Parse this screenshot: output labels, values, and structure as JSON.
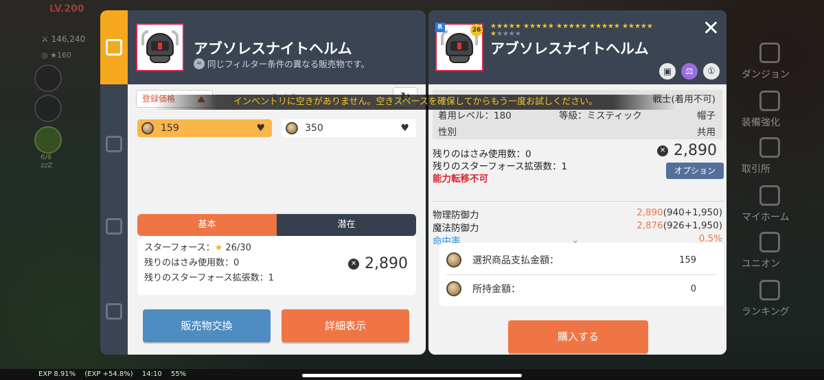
{
  "hud": {
    "level": "LV.200",
    "hp": "146,240",
    "location": "★160",
    "left_badge_count": "6/6",
    "left_badge_sub": "zzZ"
  },
  "right_menu": [
    {
      "label": "ダンジョン",
      "icon": "dungeon-icon"
    },
    {
      "label": "装備強化",
      "icon": "anvil-icon"
    },
    {
      "label": "取引所",
      "icon": "scale-icon"
    },
    {
      "label": "マイホーム",
      "icon": "mushroom-house-icon"
    },
    {
      "label": "ユニオン",
      "icon": "union-icon"
    },
    {
      "label": "ランキング",
      "icon": "trophy-icon"
    }
  ],
  "bottom_bar": {
    "exp": "EXP 8.91%",
    "exp_bonus": "(EXP +54.8%)",
    "time": "14:10",
    "battery": "55%"
  },
  "left_panel": {
    "side_tabs": [
      {
        "icon": "chart-icon",
        "active": true
      },
      {
        "icon": "helmet-icon",
        "active": false
      },
      {
        "icon": "hanger-icon",
        "active": false
      },
      {
        "icon": "heart-icon",
        "active": false
      }
    ],
    "item_name": "アブソレスナイトヘルム",
    "subtitle": "同じフィルター条件の異なる販売物です。",
    "sort_label": "登録価格",
    "pager": "1/1",
    "listings": [
      {
        "price": "159",
        "selected": true
      },
      {
        "price": "350",
        "selected": false
      }
    ],
    "tabs": {
      "basic": "基本",
      "potential": "潜在"
    },
    "info": {
      "starforce_label": "スターフォース：",
      "starforce_value": "26/30",
      "scissors": "残りのはさみ使用数：0",
      "sf_expand": "残りのスターフォース拡張数：1",
      "attack": "2,890"
    },
    "buttons": {
      "exchange": "販売物交換",
      "detail": "詳細表示"
    }
  },
  "right_panel": {
    "rank": "R",
    "starforce_badge": "26",
    "stars_filled": "★★★★★ ★★★★★ ★★★★★ ★★★★★ ★★★★★ ★",
    "stars_empty": "★★★★",
    "item_name": "アブソレスナイトヘルム",
    "req": {
      "job": "戦士(着用不可)",
      "level": "着用レベル：180",
      "grade": "等級：ミスティック",
      "slot": "帽子",
      "gender_label": "性別",
      "gender_value": "共用"
    },
    "scissors": "残りのはさみ使用数：0",
    "sf_expand": "残りのスターフォース拡張数：1",
    "no_transfer": "能力転移不可",
    "attack": "2,890",
    "option_button": "オプション",
    "stats": [
      {
        "label": "物理防御力",
        "total": "2,890",
        "detail": "(940+1,950)"
      },
      {
        "label": "魔法防御力",
        "total": "2,876",
        "detail": "(926+1,950)"
      },
      {
        "label": "命中率",
        "total": "0.5%",
        "detail": ""
      }
    ],
    "payment": {
      "selected_label": "選択商品支払金額：",
      "selected_value": "159",
      "owned_label": "所持金額：",
      "owned_value": "0"
    },
    "buy_button": "購入する"
  },
  "toast": "インベントリに空きがありません。空きスペースを確保してからもう一度お試しください。",
  "colors": {
    "panel_header": "#3b4452",
    "accent_orange": "#ef7545",
    "accent_yellow": "#f6a91e",
    "button_blue": "#4e8cc2",
    "toast_text": "#f6c61e"
  }
}
